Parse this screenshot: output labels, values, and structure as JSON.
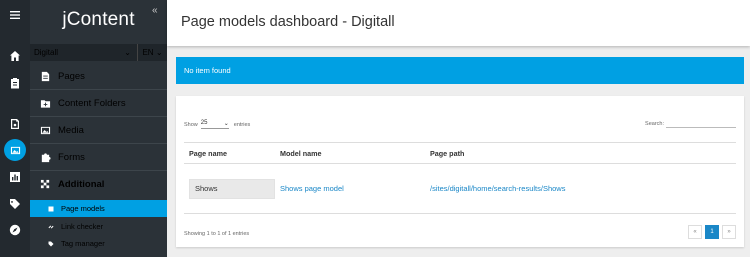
{
  "app": {
    "logo": "jContent",
    "collapse_glyph": "«"
  },
  "rail": [
    {
      "icon": "hamburger-icon"
    },
    {
      "icon": "home-icon"
    },
    {
      "icon": "clipboard-icon"
    },
    {
      "icon": "content-sync-icon"
    },
    {
      "icon": "image-icon",
      "active": true
    },
    {
      "icon": "chart-icon"
    },
    {
      "icon": "tag-icon"
    },
    {
      "icon": "compass-icon"
    }
  ],
  "selectors": {
    "site": "Digitall",
    "site_caret": "⌄",
    "language": "EN",
    "language_caret": "⌄"
  },
  "nav": {
    "pages": "Pages",
    "content_folders": "Content Folders",
    "media": "Media",
    "forms": "Forms",
    "additional": "Additional",
    "sub": {
      "page_models": "Page models",
      "link_checker": "Link checker",
      "tag_manager": "Tag manager"
    }
  },
  "main": {
    "title": "Page models dashboard - Digitall",
    "alert": "No item found",
    "table": {
      "show_label": "Show",
      "show_value": "25",
      "entries_label": "entries",
      "search_label": "Search:",
      "search_value": "",
      "headers": {
        "page_name": "Page name",
        "model_name": "Model name",
        "page_path": "Page path"
      },
      "rows": [
        {
          "page_name": "Shows",
          "model_name": "Shows page model",
          "page_path": "/sites/digitall/home/search-results/Shows"
        }
      ],
      "info": "Showing 1 to 1 of 1 entries",
      "pager": {
        "prev": "«",
        "page": "1",
        "next": "»"
      }
    }
  },
  "colors": {
    "accent": "#00a0e3",
    "rail": "#23292f",
    "panel": "#2b3238",
    "link": "#1a87c7"
  }
}
